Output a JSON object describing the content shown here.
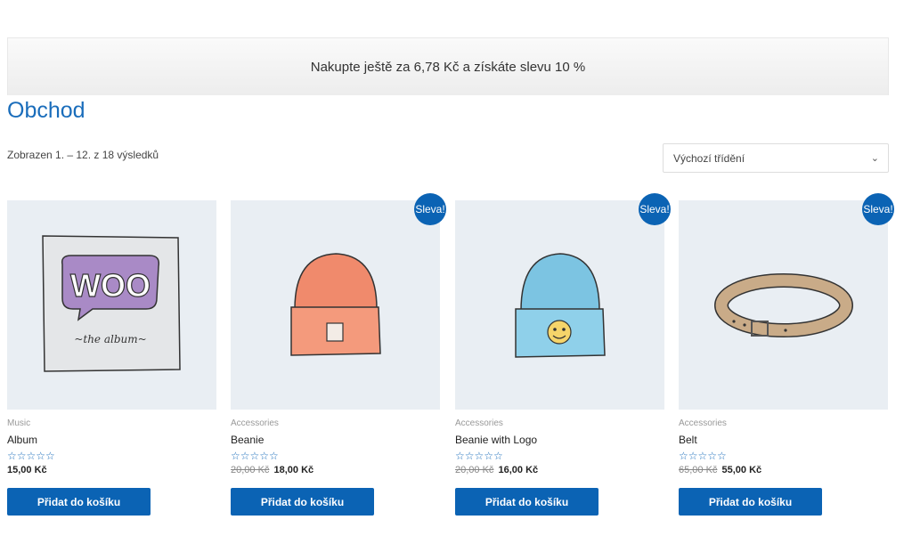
{
  "notice": {
    "text": "Nakupte ještě za 6,78 Kč a získáte slevu 10 %"
  },
  "page": {
    "title": "Obchod"
  },
  "results": {
    "count_text": "Zobrazen 1. – 12. z 18 výsledků"
  },
  "ordering": {
    "selected": "Výchozí třídění"
  },
  "accent_color": "#0b63b4",
  "rating_stars": "☆☆☆☆☆",
  "products": [
    {
      "category": "Music",
      "name": "Album",
      "old_price": "",
      "price": "15,00 Kč",
      "sale_badge": "",
      "button": "Přidat do košíku",
      "image_icon": "woo-album-icon"
    },
    {
      "category": "Accessories",
      "name": "Beanie",
      "old_price": "20,00 Kč",
      "price": "18,00 Kč",
      "sale_badge": "Sleva!",
      "button": "Přidat do košíku",
      "image_icon": "orange-beanie-icon"
    },
    {
      "category": "Accessories",
      "name": "Beanie with Logo",
      "old_price": "20,00 Kč",
      "price": "16,00 Kč",
      "sale_badge": "Sleva!",
      "button": "Přidat do košíku",
      "image_icon": "blue-beanie-logo-icon"
    },
    {
      "category": "Accessories",
      "name": "Belt",
      "old_price": "65,00 Kč",
      "price": "55,00 Kč",
      "sale_badge": "Sleva!",
      "button": "Přidat do košíku",
      "image_icon": "belt-icon"
    }
  ]
}
